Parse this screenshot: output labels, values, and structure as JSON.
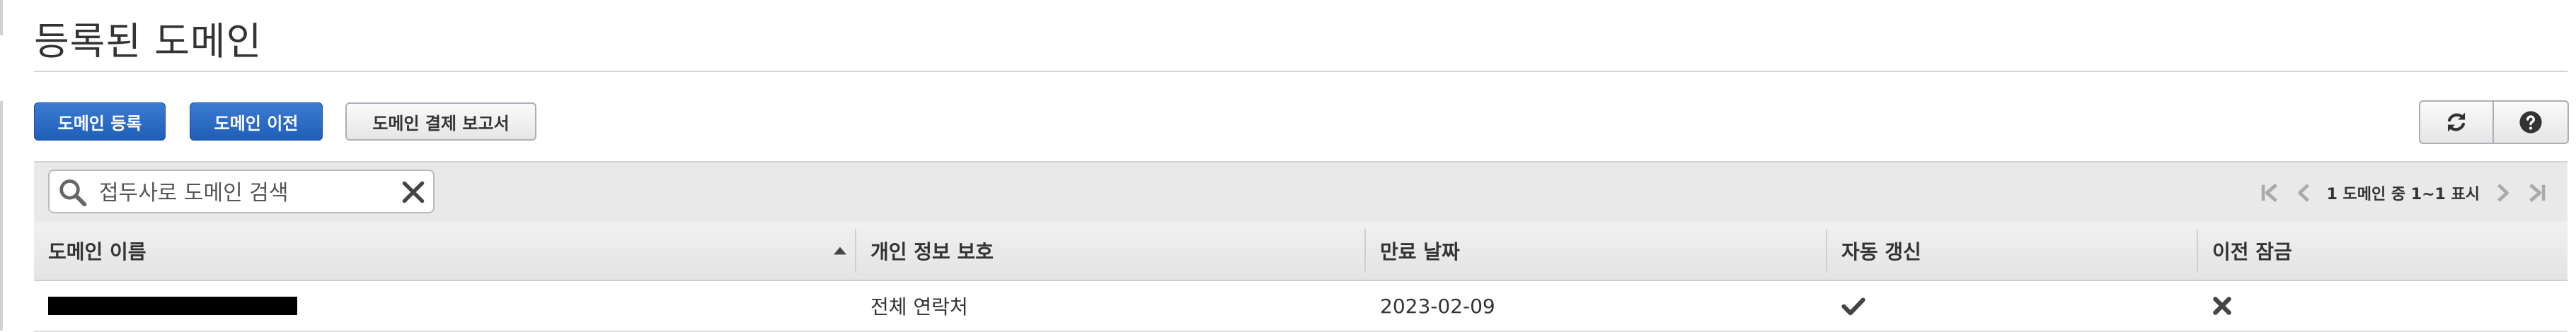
{
  "page": {
    "title": "등록된 도메인"
  },
  "toolbar": {
    "register_label": "도메인 등록",
    "transfer_label": "도메인 이전",
    "billing_report_label": "도메인 결제 보고서",
    "refresh_icon": "refresh-icon",
    "help_icon": "question-icon"
  },
  "filter": {
    "search_placeholder": "접두사로 도메인 검색",
    "search_value": "",
    "pager_text": "1 도메인 중 1~1 표시"
  },
  "table": {
    "columns": [
      "도메인 이름",
      "개인 정보 보호",
      "만료 날짜",
      "자동 갱신",
      "이전 잠금"
    ],
    "sort_column": "도메인 이름",
    "sort_direction": "ascending",
    "rows": [
      {
        "domain_name": "",
        "domain_redacted": true,
        "privacy": "전체 연락처",
        "expiration": "2023-02-09",
        "auto_renew": "check-icon",
        "transfer_lock": "x-icon"
      }
    ]
  },
  "colors": {
    "primary_button": "#2767c1",
    "header_bg": "#e9e9e9"
  }
}
